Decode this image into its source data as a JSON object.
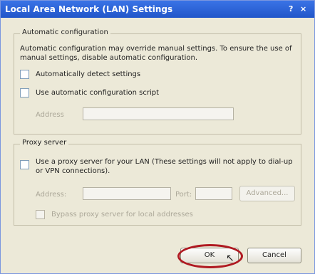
{
  "window": {
    "title": "Local Area Network (LAN) Settings",
    "help_glyph": "?",
    "close_glyph": "×"
  },
  "auto_config": {
    "legend": "Automatic configuration",
    "description": "Automatic configuration may override manual settings. To ensure the use of manual settings, disable automatic configuration.",
    "detect_label": "Automatically detect settings",
    "script_label": "Use automatic configuration script",
    "address_label": "Address"
  },
  "proxy": {
    "legend": "Proxy server",
    "use_proxy_label": "Use a proxy server for your LAN (These settings will not apply to dial-up or VPN connections).",
    "address_label": "Address:",
    "port_label": "Port:",
    "advanced_label": "Advanced...",
    "bypass_label": "Bypass proxy server for local addresses"
  },
  "footer": {
    "ok_label": "OK",
    "cancel_label": "Cancel",
    "cursor_glyph": "↖"
  },
  "colors": {
    "highlight_ring": "#b01a22",
    "titlebar": "#2156c9"
  }
}
